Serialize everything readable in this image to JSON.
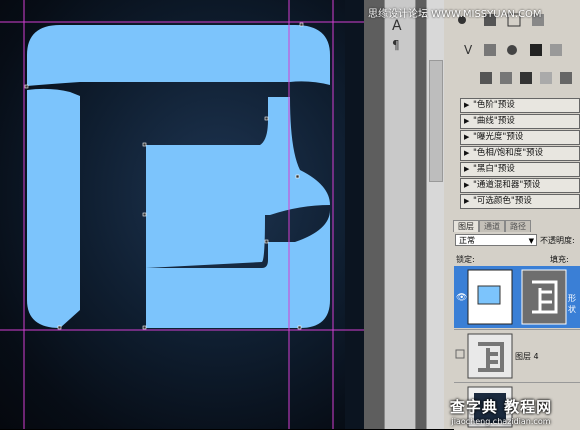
{
  "watermark_top": "思缘设计论坛  WWW.MISSYUAN.COM",
  "panel_strip": {
    "char_tool": "A",
    "para_tool": "¶"
  },
  "adjustments": {
    "presets": [
      "\"色阶\"预设",
      "\"曲线\"预设",
      "\"曝光度\"预设",
      "\"色相/饱和度\"预设",
      "\"黑白\"预设",
      "\"通道混和器\"预设",
      "\"可选颜色\"预设"
    ]
  },
  "layers_panel": {
    "tabs": [
      "图层",
      "通道",
      "路径"
    ],
    "blend_mode": "正常",
    "opacity_label": "不透明度:",
    "lock_label": "锁定:",
    "fill_label": "填充:",
    "layers": [
      {
        "name": "形状",
        "selected": true
      },
      {
        "name": "图层 4",
        "selected": false
      },
      {
        "name": "",
        "selected": false
      }
    ]
  },
  "site_watermark": {
    "name": "查字典 教程网",
    "url": "jiaocheng.chazidian.com"
  },
  "colors": {
    "shape": "#7cc4fc",
    "guide": "#d23fd2",
    "selection": "#3a7fd6"
  }
}
